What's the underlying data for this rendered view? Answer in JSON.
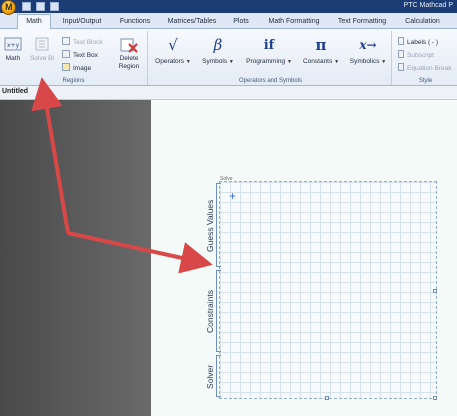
{
  "window": {
    "title": "PTC Mathcad P"
  },
  "tabs": [
    {
      "label": "Math",
      "active": true
    },
    {
      "label": "Input/Output"
    },
    {
      "label": "Functions"
    },
    {
      "label": "Matrices/Tables"
    },
    {
      "label": "Plots"
    },
    {
      "label": "Math Formatting"
    },
    {
      "label": "Text Formatting"
    },
    {
      "label": "Calculation"
    }
  ],
  "ribbon": {
    "regions": {
      "label": "Regions",
      "math": "Math",
      "solve_block": "Solve Bl",
      "text_block": "Text Block",
      "text_box": "Text Box",
      "image": "Image",
      "delete_region": "Delete Region"
    },
    "operators_symbols": {
      "label": "Operators and Symbols",
      "operators": "Operators",
      "symbols": "Symbols",
      "programming": "Programming",
      "constants": "Constants",
      "symbolics": "Symbolics",
      "glyph_operators": "√",
      "glyph_symbols": "β",
      "glyph_programming": "if",
      "glyph_constants": "π",
      "glyph_symbolics": "x→"
    },
    "style": {
      "label": "Style",
      "labels": "Labels  ( - )",
      "subscript": "Subscript",
      "equation_break": "Equation Break"
    }
  },
  "document": {
    "tab_title": "Untitled"
  },
  "solve_block": {
    "corner_label": "Solve",
    "sections": {
      "guess": "Guess Values",
      "constraints": "Constraints",
      "solver": "Solver"
    }
  },
  "colors": {
    "arrow": "#d94848",
    "titlebar": "#1b3c74"
  }
}
